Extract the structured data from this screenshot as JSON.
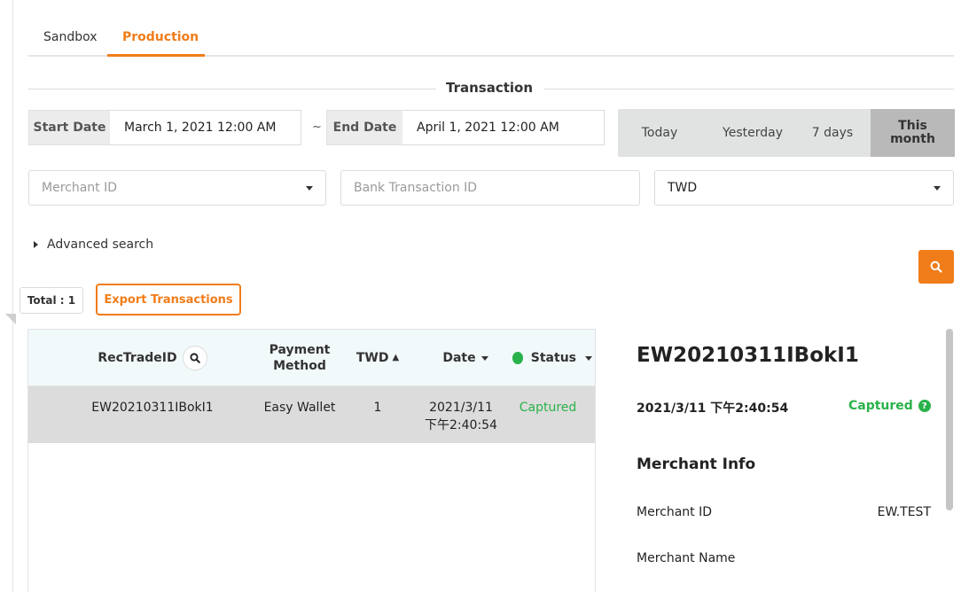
{
  "tabs": [
    {
      "label": "Sandbox",
      "active": false
    },
    {
      "label": "Production",
      "active": true
    }
  ],
  "section_title": "Transaction",
  "date_range": {
    "start_label": "Start Date",
    "start_value": "March 1, 2021 12:00 AM",
    "separator": "~",
    "end_label": "End Date",
    "end_value": "April 1, 2021 12:00 AM"
  },
  "quick_ranges": [
    {
      "label": "Today",
      "active": false
    },
    {
      "label": "Yesterday",
      "active": false
    },
    {
      "label": "7 days",
      "active": false
    },
    {
      "label": "This month",
      "active": true
    }
  ],
  "filters": {
    "merchant_placeholder": "Merchant ID",
    "bank_txn_placeholder": "Bank Transaction ID",
    "currency_value": "TWD"
  },
  "advanced_search_label": "Advanced search",
  "total_label": "Total : 1",
  "export_label": "Export Transactions",
  "table": {
    "columns": {
      "rec_trade_id": "RecTradeID",
      "payment_method": "Payment Method",
      "amount": "TWD",
      "date": "Date",
      "status": "Status"
    },
    "rows": [
      {
        "rec_trade_id": "EW20210311IBokI1",
        "payment_method": "Easy Wallet",
        "amount": "1",
        "date_line1": "2021/3/11",
        "date_line2": "下午2:40:54",
        "status": "Captured"
      }
    ]
  },
  "detail": {
    "title": "EW20210311IBokI1",
    "datetime": "2021/3/11 下午2:40:54",
    "status": "Captured",
    "merchant_info_heading": "Merchant Info",
    "merchant_id_label": "Merchant ID",
    "merchant_id_value": "EW.TEST",
    "merchant_name_label": "Merchant Name"
  },
  "colors": {
    "accent": "#f07d1a",
    "success": "#2ab24a",
    "table_header_bg": "#f2f9fb",
    "selected_row_bg": "#dcdcdc"
  },
  "icons": [
    "search-icon",
    "sort-updown-icon",
    "sort-down-icon",
    "chevron-down-icon",
    "help-circle-icon",
    "triangle-right-icon"
  ]
}
